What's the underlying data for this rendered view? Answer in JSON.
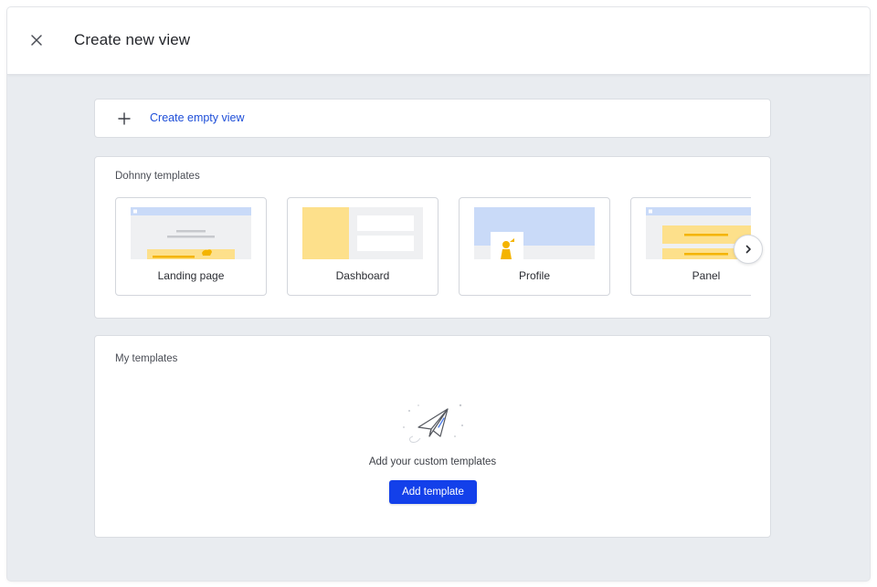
{
  "header": {
    "title": "Create new view",
    "close_icon": "close-icon"
  },
  "create_empty": {
    "icon": "plus-icon",
    "label": "Create empty view"
  },
  "dohnny_templates": {
    "label": "Dohnny templates",
    "items": [
      {
        "name": "Landing page",
        "thumb": "landing-page-thumbnail"
      },
      {
        "name": "Dashboard",
        "thumb": "dashboard-thumbnail"
      },
      {
        "name": "Profile",
        "thumb": "profile-thumbnail"
      },
      {
        "name": "Panel",
        "thumb": "panel-thumbnail"
      }
    ],
    "next_icon": "chevron-right-icon"
  },
  "my_templates": {
    "label": "My templates",
    "empty_icon": "paper-plane-icon",
    "empty_text": "Add your custom templates",
    "add_button": "Add template"
  },
  "colors": {
    "accent": "#1340ea",
    "link": "#1f4fd8",
    "thumb_blue": "#c9daf8",
    "thumb_yellow": "#fde08b",
    "thumb_orange": "#f4b400",
    "background": "#e9ecf0"
  }
}
